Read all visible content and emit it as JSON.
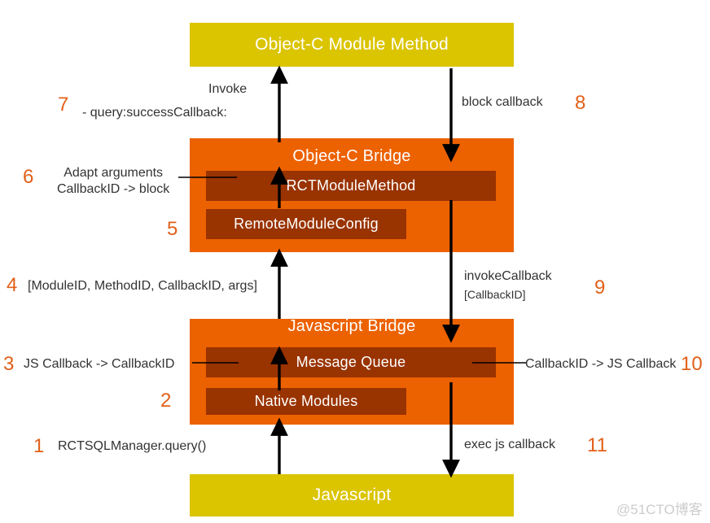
{
  "diagram": {
    "title_layers": {
      "top": "Object-C Module Method",
      "bottom": "Javascript",
      "oc_bridge": "Object-C Bridge",
      "js_bridge": "Javascript Bridge"
    },
    "inner_boxes": {
      "rct_module_method": "RCTModuleMethod",
      "remote_module_config": "RemoteModuleConfig",
      "message_queue": "Message Queue",
      "native_modules": "Native Modules"
    },
    "steps": {
      "s1": "1",
      "s2": "2",
      "s3": "3",
      "s4": "4",
      "s5": "5",
      "s6": "6",
      "s7": "7",
      "s8": "8",
      "s9": "9",
      "s10": "10",
      "s11": "11"
    },
    "notes": {
      "invoke": "Invoke",
      "query_success_callback": "- query:successCallback:",
      "adapt_arguments": "Adapt arguments",
      "callbackid_to_block": "CallbackID -> block",
      "module_ids": "[ModuleID, MethodID, CallbackID, args]",
      "js_callback_to_id": "JS Callback -> CallbackID",
      "rctsqlmanager_query": "RCTSQLManager.query()",
      "block_callback": "block callback",
      "invoke_callback": "invokeCallback",
      "callback_id_bracket": "[CallbackID]",
      "id_to_js_callback": "CallbackID -> JS Callback",
      "exec_js_callback": "exec js callback"
    },
    "watermark": "@51CTO博客",
    "colors": {
      "yellow": "#dbc400",
      "orange": "#ec6100",
      "dark_brown": "#993300",
      "step_number": "#e2601a",
      "note_text": "#333333",
      "arrow": "#000000"
    }
  }
}
